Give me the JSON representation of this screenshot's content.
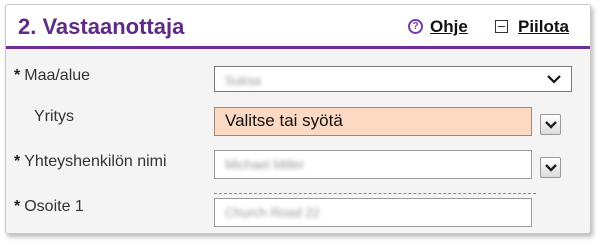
{
  "header": {
    "title": "2. Vastaanottaja",
    "help_label": "Ohje",
    "hide_label": "Piilota"
  },
  "form": {
    "country": {
      "required_mark": "*",
      "label": "Maa/alue",
      "value": "Suksa"
    },
    "company": {
      "label": "Yritys",
      "value": "Valitse tai syötä"
    },
    "contact_name": {
      "required_mark": "*",
      "label": "Yhteyshenkilön nimi",
      "value": "Michael Miller"
    },
    "address1": {
      "required_mark": "*",
      "label": "Osoite 1",
      "value": "Church Road 22"
    }
  },
  "colors": {
    "accent": "#5e2b86",
    "header_rule": "#6d2f96",
    "company_field_bg": "#fbd9c2"
  }
}
